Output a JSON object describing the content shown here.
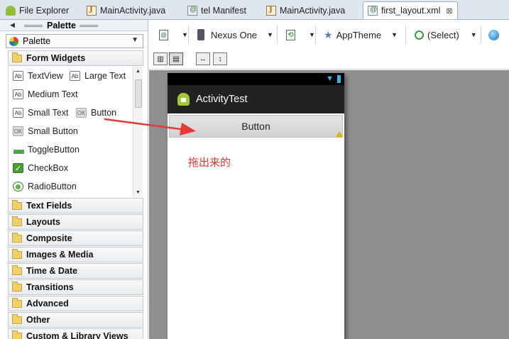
{
  "tabs": [
    {
      "label": "File Explorer",
      "icon": "android-icon"
    },
    {
      "label": "MainActivity.java",
      "icon": "java-file-icon"
    },
    {
      "label": "tel Manifest",
      "icon": "xml-file-icon"
    },
    {
      "label": "MainActivity.java",
      "icon": "java-file-icon"
    },
    {
      "label": "first_layout.xml",
      "icon": "xml-file-icon",
      "active": true,
      "close": "⊠"
    }
  ],
  "palette": {
    "title": "Palette",
    "select_value": "Palette",
    "categories": [
      "Form Widgets",
      "Text Fields",
      "Layouts",
      "Composite",
      "Images & Media",
      "Time & Date",
      "Transitions",
      "Advanced",
      "Other",
      "Custom & Library Views"
    ],
    "widgets": {
      "textview": {
        "badge": "Ab",
        "label": "TextView"
      },
      "large_text": {
        "badge": "Ab",
        "label": "Large Text"
      },
      "medium_text": {
        "badge": "Ab",
        "label": "Medium Text"
      },
      "small_text": {
        "badge": "Ab",
        "label": "Small Text"
      },
      "button": {
        "badge": "OK",
        "label": "Button"
      },
      "small_button": {
        "badge": "OK",
        "label": "Small Button"
      },
      "toggle_button": {
        "label": "ToggleButton"
      },
      "checkbox": {
        "badge": "✓",
        "label": "CheckBox"
      },
      "radio_button": {
        "label": "RadioButton"
      }
    }
  },
  "toolbar": {
    "device": "Nexus One",
    "theme": "AppTheme",
    "activity": "(Select)"
  },
  "device": {
    "app_title": "ActivityTest",
    "button_label": "Button",
    "annotation": "拖出来的"
  },
  "colors": {
    "arrow": "#e53935",
    "action_bar": "#222222",
    "canvas": "#8f8f8f",
    "status_icons": "#33b5e5",
    "annotation": "#dd3333"
  }
}
